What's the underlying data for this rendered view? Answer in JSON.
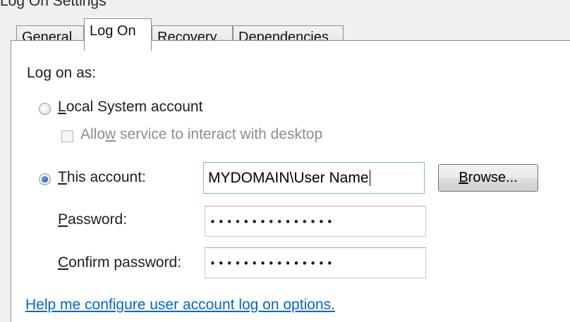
{
  "window": {
    "title_fragment": "Log On Settings"
  },
  "tabs": [
    {
      "label": "General",
      "selected": false
    },
    {
      "label": "Log On",
      "selected": true
    },
    {
      "label": "Recovery",
      "selected": false
    },
    {
      "label": "Dependencies",
      "selected": false
    }
  ],
  "logon": {
    "heading": "Log on as:",
    "local_system": {
      "accel": "L",
      "rest": "ocal System account",
      "checked": false
    },
    "interact_desktop": {
      "pre": "Allo",
      "accel": "w",
      "post": " service to interact with desktop",
      "checked": false,
      "disabled": true
    },
    "this_account": {
      "accel": "T",
      "rest": "his account:",
      "checked": true,
      "value": "MYDOMAIN\\User Name"
    },
    "browse_button": {
      "accel": "B",
      "rest": "rowse..."
    },
    "password": {
      "accel": "P",
      "rest": "assword:",
      "value": "•••••••••••••••"
    },
    "confirm_password": {
      "accel": "C",
      "rest": "onfirm password:",
      "value": "•••••••••••••••"
    },
    "help_link": "Help me configure user account log on options."
  }
}
